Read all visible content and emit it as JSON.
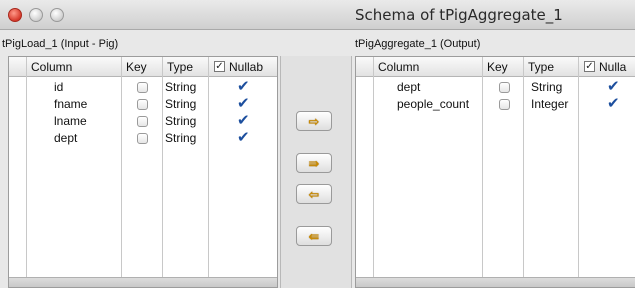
{
  "window": {
    "title": "Schema of tPigAggregate_1"
  },
  "left_panel": {
    "label": "tPigLoad_1 (Input - Pig)",
    "columns": [
      "Column",
      "Key",
      "Type",
      "Nullab"
    ],
    "rows": [
      {
        "column": "id",
        "key": false,
        "type": "String",
        "nullable": true
      },
      {
        "column": "fname",
        "key": false,
        "type": "String",
        "nullable": true
      },
      {
        "column": "lname",
        "key": false,
        "type": "String",
        "nullable": true
      },
      {
        "column": "dept",
        "key": false,
        "type": "String",
        "nullable": true
      }
    ]
  },
  "right_panel": {
    "label": "tPigAggregate_1 (Output)",
    "columns": [
      "Column",
      "Key",
      "Type",
      "Nulla"
    ],
    "rows": [
      {
        "column": "dept",
        "key": false,
        "type": "String",
        "nullable": true
      },
      {
        "column": "people_count",
        "key": false,
        "type": "Integer",
        "nullable": true
      }
    ]
  },
  "middle_buttons": {
    "copy_one": "⇨",
    "copy_all": "⇛",
    "copy_back_one": "⇦",
    "copy_back_all": "⇚"
  },
  "colors": {
    "check": "#1d4f9e",
    "arrow": "#c98a00"
  }
}
